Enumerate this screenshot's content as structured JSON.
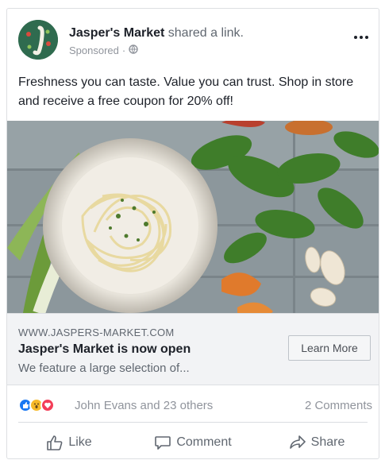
{
  "post": {
    "page_name": "Jasper's Market",
    "action_text": " shared a link.",
    "sponsored": "Sponsored",
    "meta_separator": "·",
    "body_text": "Freshness you can taste. Value you can trust. Shop in store and receive a free coupon for 20% off!"
  },
  "link": {
    "domain": "WWW.JASPERS-MARKET.COM",
    "title": "Jasper's Market is now open",
    "description": "We feature a large selection of...",
    "cta_label": "Learn More"
  },
  "engagement": {
    "reactions": [
      "like",
      "wow",
      "love"
    ],
    "reacted_by": "John Evans and 23 others",
    "comments": "2 Comments"
  },
  "actions": {
    "like": "Like",
    "comment": "Comment",
    "share": "Share"
  },
  "colors": {
    "like_blue": "#1877f2",
    "wow_yellow": "#f7b928",
    "love_red": "#f33e58",
    "text_secondary": "#606770"
  },
  "icons": {
    "globe": "globe-icon",
    "more": "more-options-icon",
    "like": "thumbs-up-icon",
    "comment": "speech-bubble-icon",
    "share": "share-arrow-icon"
  }
}
